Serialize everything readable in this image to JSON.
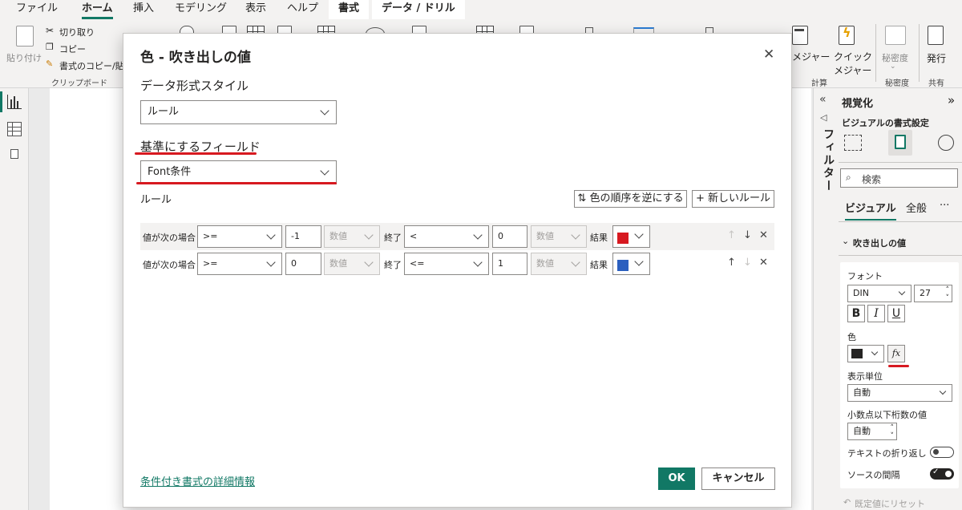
{
  "menu": {
    "tabs": [
      "ファイル",
      "ホーム",
      "挿入",
      "モデリング",
      "表示",
      "ヘルプ",
      "書式",
      "データ / ドリル"
    ],
    "active": "ホーム"
  },
  "ribbon": {
    "paste": "貼り付け",
    "cut": "切り取り",
    "copy": "コピー",
    "format_copy": "書式のコピー/貼",
    "clipboard_group": "クリップボード",
    "measure": "メジャー",
    "quick_measure": "クイック",
    "quick_measure2": "メジャー",
    "calc_group": "計算",
    "sensitivity": "秘密度",
    "sensitivity_group": "秘密度",
    "publish": "発行",
    "share_group": "共有"
  },
  "filter_pane": {
    "label": "フィルター"
  },
  "right_pane": {
    "title": "視覚化",
    "subtitle": "ビジュアルの書式設定",
    "search_placeholder": "検索",
    "tabs": [
      "ビジュアル",
      "全般"
    ],
    "more": "···",
    "section": "吹き出しの値",
    "font_label": "フォント",
    "font_family": "DIN",
    "font_size": "27",
    "bold": "B",
    "italic": "I",
    "underline": "U",
    "color_label": "色",
    "fx": "fx",
    "display_units_label": "表示単位",
    "display_units_value": "自動",
    "decimals_label": "小数点以下桁数の値",
    "decimals_value": "自動",
    "wrap_label": "テキストの折り返し",
    "spacing_label": "ソースの間隔",
    "reset": "既定値にリセット"
  },
  "dialog": {
    "title": "色 - 吹き出しの値",
    "format_style_label": "データ形式スタイル",
    "format_style_value": "ルール",
    "base_field_label": "基準にするフィールド",
    "base_field_value": "Font条件",
    "rules_label": "ルール",
    "reverse_button": "色の順序を逆にする",
    "reverse_icon": "⇅",
    "new_rule_button": "新しいルール",
    "new_rule_icon": "+",
    "rules": [
      {
        "if_label": "値が次の場合",
        "op1": ">=",
        "val1": "-1",
        "type1": "数値",
        "end_label": "終了",
        "op2": "<",
        "val2": "0",
        "type2": "数値",
        "result_label": "結果",
        "color": "#d71920"
      },
      {
        "if_label": "値が次の場合",
        "op1": ">=",
        "val1": "0",
        "type1": "数値",
        "end_label": "終了",
        "op2": "<=",
        "val2": "1",
        "type2": "数値",
        "result_label": "結果",
        "color": "#2b5fbf"
      }
    ],
    "learn_more": "条件付き書式の詳細情報",
    "ok": "OK",
    "cancel": "キャンセル"
  },
  "colors": {
    "accent": "#117865",
    "annotation_red": "#d71920",
    "rule1_color": "#d71920",
    "rule2_color": "#2b5fbf"
  }
}
